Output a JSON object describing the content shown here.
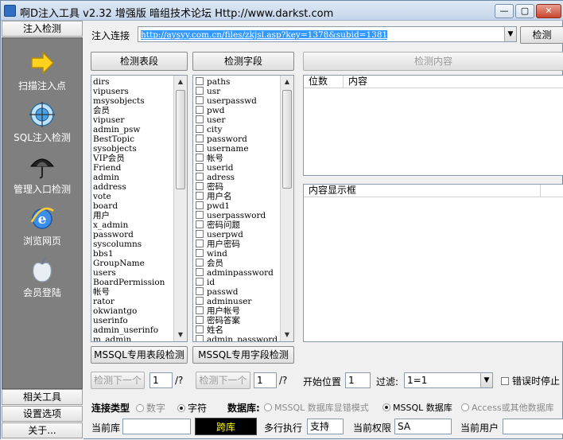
{
  "window": {
    "title": "啊D注入工具 v2.32 增强版 暗组技术论坛 Http://www.darkst.com",
    "min": "—",
    "max": "▢",
    "close": "✕"
  },
  "sidebar": {
    "top_button": "注入检测",
    "items": [
      {
        "label": "扫描注入点",
        "icon": "arrow-icon"
      },
      {
        "label": "SQL注入检测",
        "icon": "globe-target-icon"
      },
      {
        "label": "管理入口检测",
        "icon": "umbrella-icon"
      },
      {
        "label": "浏览网页",
        "icon": "ie-browser-icon"
      },
      {
        "label": "会员登陆",
        "icon": "apple-icon"
      }
    ],
    "bottom_buttons": [
      "相关工具",
      "设置选项",
      "关于..."
    ]
  },
  "url_bar": {
    "label": "注入连接",
    "value": "http://aysyy.com.cn/files/zkjsl.asp?key=1378&subid=1381",
    "detect_button": "检测"
  },
  "columns": {
    "tables_button": "检测表段",
    "fields_button": "检测字段",
    "content_button": "检测内容"
  },
  "tables": [
    "dirs",
    "vipusers",
    "msysobjects",
    "会员",
    "vipuser",
    "admin_psw",
    "BestTopic",
    "sysobjects",
    "VIP会员",
    "Friend",
    "admin",
    "address",
    "vote",
    "board",
    "用户",
    "x_admin",
    "password",
    "syscolumns",
    "bbs1",
    "GroupName",
    "users",
    "BoardPermission",
    "帐号",
    "rator",
    "okwiantgo",
    "userinfo",
    "admin_userinfo",
    "m_admin"
  ],
  "fields": [
    "paths",
    "usr",
    "userpasswd",
    "pwd",
    "user",
    "city",
    "password",
    "username",
    "帐号",
    "userid",
    "adress",
    "密码",
    "用户名",
    "pwd1",
    "userpassword",
    "密码问题",
    "userpwd",
    "用户密码",
    "wind",
    "会员",
    "adminpassword",
    "id",
    "passwd",
    "adminuser",
    "用户帐号",
    "密码答案",
    "姓名",
    "admin_password"
  ],
  "content_table": {
    "col1": "位数",
    "col2": "内容"
  },
  "content_box": {
    "header": "内容显示框"
  },
  "mssql_buttons": {
    "tables": "MSSQL专用表段检测",
    "fields": "MSSQL专用字段检测"
  },
  "paging": {
    "next1": "检测下一个",
    "page1": "1",
    "total1": "/?",
    "next2": "检测下一个",
    "page2": "1",
    "total2": "/?",
    "start_label": "开始位置",
    "start_value": "1",
    "filter_label": "过滤:",
    "filter_value": "1=1",
    "stop_on_error": "错误时停止"
  },
  "options": {
    "conn_type_label": "连接类型",
    "conn_number": "数字",
    "conn_string": "字符",
    "db_label": "数据库:",
    "db_mssql_error": "MSSQL 数据库显错模式",
    "db_mssql": "MSSQL 数据库",
    "db_access": "Access或其他数据库"
  },
  "status": {
    "current_db_label": "当前库",
    "current_db_value": "",
    "cross_db": "跨库",
    "multi_exec_label": "多行执行",
    "multi_exec_value": "支持",
    "perm_label": "当前权限",
    "perm_value": "SA",
    "user_label": "当前用户",
    "user_value": ""
  },
  "colors": {
    "cross_db_bg": "#000000",
    "cross_db_fg": "#ffff00",
    "url_highlight": "#3399ff",
    "sidebar_bg": "#7f7f7f"
  }
}
